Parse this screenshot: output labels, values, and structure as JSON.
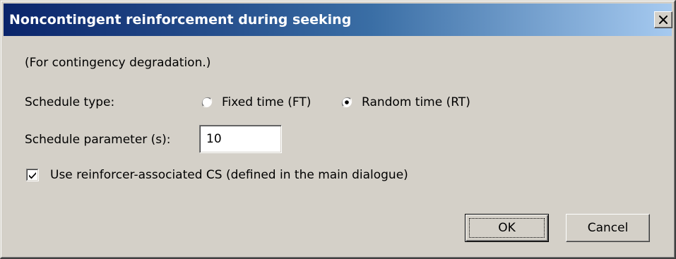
{
  "window": {
    "title": "Noncontingent reinforcement during seeking",
    "close_glyph": "✕"
  },
  "intro_text": "(For contingency degradation.)",
  "schedule_type": {
    "label": "Schedule type:",
    "options": [
      {
        "label": "Fixed time (FT)",
        "selected": false
      },
      {
        "label": "Random time (RT)",
        "selected": true
      }
    ]
  },
  "schedule_parameter": {
    "label": "Schedule parameter (s):",
    "value": "10"
  },
  "use_cs": {
    "label": "Use reinforcer-associated CS (defined in the main dialogue)",
    "checked": true
  },
  "buttons": {
    "ok": "OK",
    "cancel": "Cancel"
  },
  "icons": {
    "close": "close-icon",
    "radio": "radio-icon",
    "check": "checkmark-icon"
  },
  "colors": {
    "face": "#d4d0c8",
    "title_start": "#0a246a",
    "title_end": "#a6caf0"
  }
}
